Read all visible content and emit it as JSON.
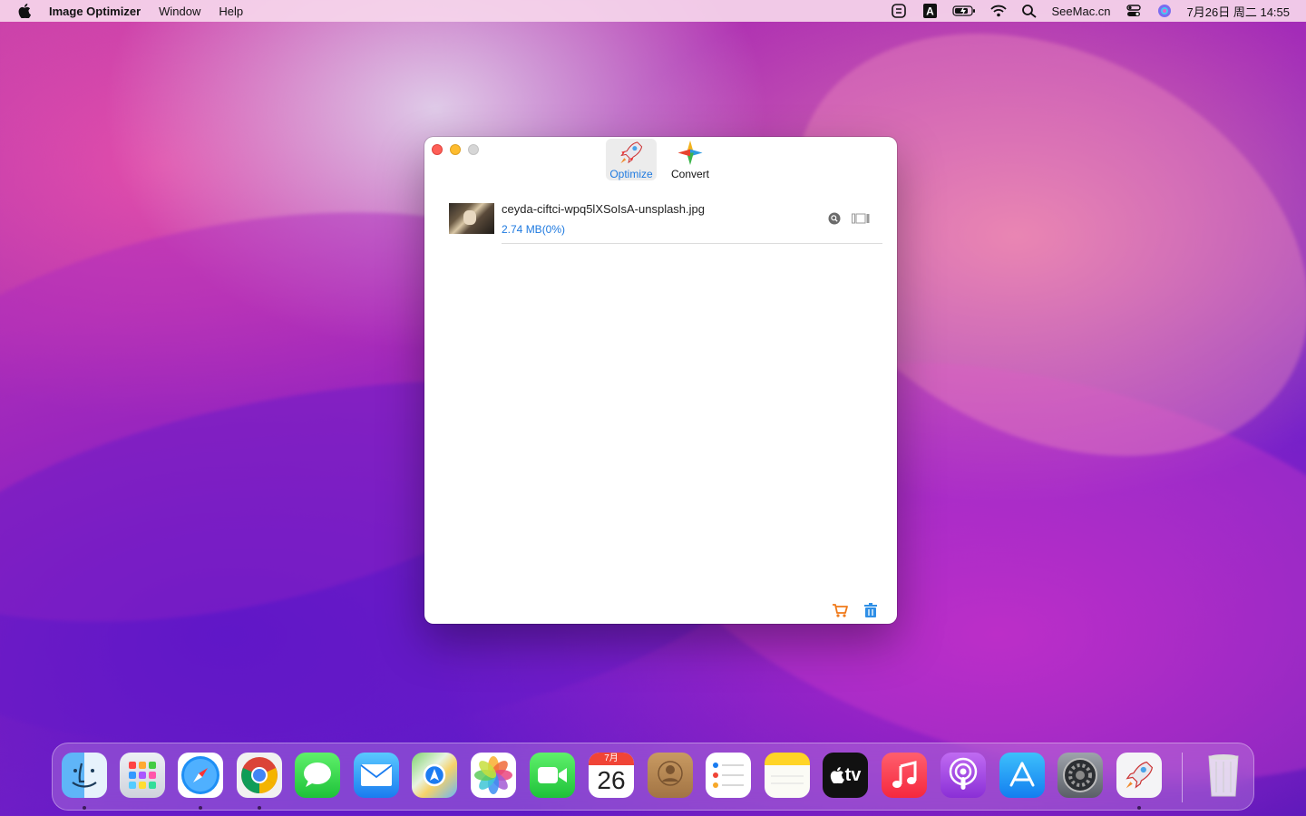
{
  "menubar": {
    "app_name": "Image Optimizer",
    "menus": [
      "Window",
      "Help"
    ],
    "status_site": "SeeMac.cn",
    "datetime": "7月26日 周二  14:55",
    "status_icons": [
      "grammarly-icon",
      "input-method-icon",
      "battery-icon",
      "wifi-icon",
      "spotlight-icon",
      "control-center-icon",
      "siri-icon"
    ]
  },
  "window": {
    "toolbar": {
      "optimize_label": "Optimize",
      "convert_label": "Convert",
      "active": "Optimize"
    },
    "files": [
      {
        "name": "ceyda-ciftci-wpq5lXSoIsA-unsplash.jpg",
        "size": "2.74 MB(0%)"
      }
    ]
  },
  "dock": {
    "apps": [
      "Finder",
      "Launchpad",
      "Safari",
      "Chrome",
      "Messages",
      "Mail",
      "Maps",
      "Photos",
      "FaceTime",
      "Calendar",
      "Contacts",
      "Reminders",
      "Notes",
      "TV",
      "Music",
      "Podcasts",
      "App Store",
      "System Preferences",
      "Image Optimizer",
      "Trash"
    ],
    "calendar_month": "7月",
    "calendar_day": "26",
    "tv_label": "tv",
    "running": [
      "Finder",
      "Safari",
      "Chrome",
      "Image Optimizer"
    ]
  },
  "colors": {
    "accent": "#1f7ae0",
    "close": "#fe5f57",
    "minimize": "#febc2e"
  }
}
